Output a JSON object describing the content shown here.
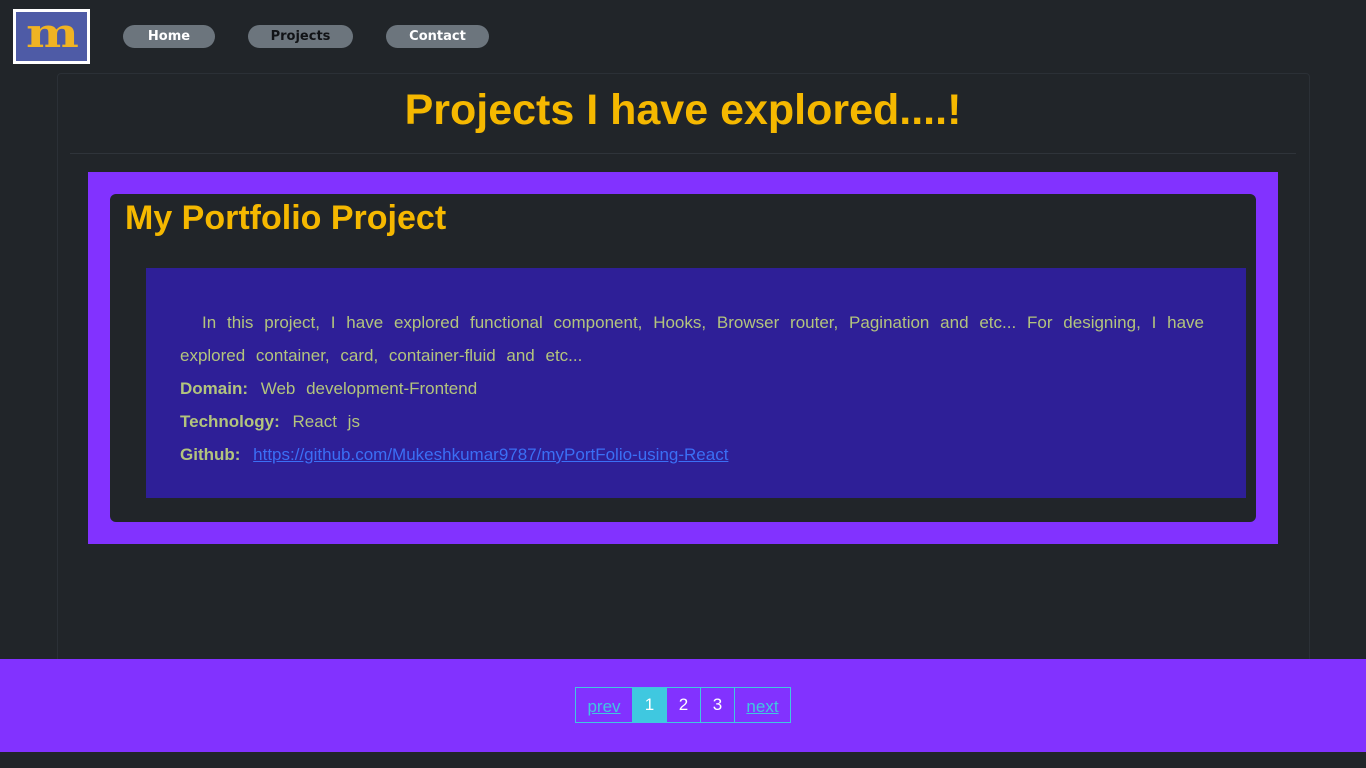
{
  "header": {
    "logo_letter": "m",
    "nav": {
      "home": "Home",
      "projects": "Projects",
      "contact": "Contact"
    }
  },
  "main": {
    "title": "Projects I have explored....!",
    "project": {
      "title": "My Portfolio Project",
      "description": "In this project, I have explored functional component, Hooks, Browser router, Pagination and etc... For designing, I have explored container, card, container-fluid and etc...",
      "domain_label": "Domain:",
      "domain_value": "Web development-Frontend",
      "technology_label": "Technology:",
      "technology_value": "React js",
      "github_label": "Github:",
      "github_link": "https://github.com/Mukeshkumar9787/myPortFolio-using-React"
    }
  },
  "pagination": {
    "prev": "prev",
    "pages": [
      "1",
      "2",
      "3"
    ],
    "active_page": "1",
    "next": "next"
  },
  "colors": {
    "background": "#212529",
    "accent_purple": "#8232ff",
    "title_yellow": "#f5b800",
    "project_body": "#2e1f97",
    "pagination_cyan": "#3fc8e0",
    "nav_gray": "#6c757d"
  }
}
